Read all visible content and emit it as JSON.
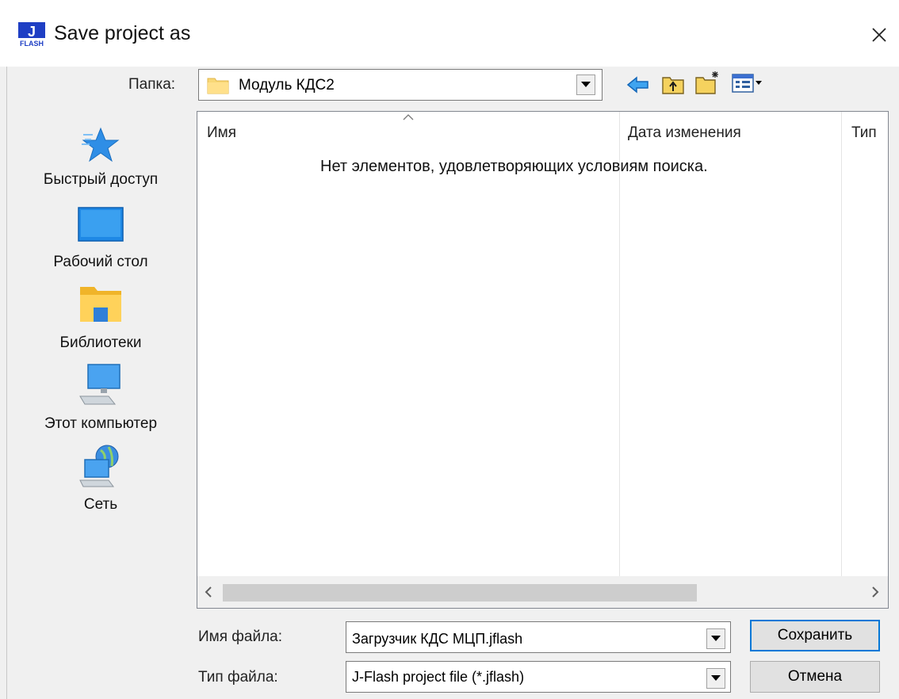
{
  "window": {
    "title": "Save project as"
  },
  "location": {
    "label": "Папка:",
    "value": "Модуль КДС2"
  },
  "toolbar": {
    "back_icon": "back-arrow-icon",
    "up_icon": "folder-up-icon",
    "new_folder_icon": "new-folder-icon",
    "view_icon": "view-menu-icon"
  },
  "places": [
    {
      "label": "Быстрый доступ",
      "icon": "quick-access-star-icon"
    },
    {
      "label": "Рабочий стол",
      "icon": "desktop-icon"
    },
    {
      "label": "Библиотеки",
      "icon": "libraries-icon"
    },
    {
      "label": "Этот компьютер",
      "icon": "computer-icon"
    },
    {
      "label": "Сеть",
      "icon": "network-icon"
    }
  ],
  "file_list": {
    "columns": [
      "Имя",
      "Дата изменения",
      "Тип"
    ],
    "empty_message": "Нет элементов, удовлетворяющих условиям поиска."
  },
  "filename": {
    "label": "Имя файла:",
    "value": "Загрузчик КДС МЦП.jflash"
  },
  "filetype": {
    "label": "Тип файла:",
    "value": "J-Flash project file (*.jflash)"
  },
  "buttons": {
    "save": "Сохранить",
    "cancel": "Отмена"
  }
}
